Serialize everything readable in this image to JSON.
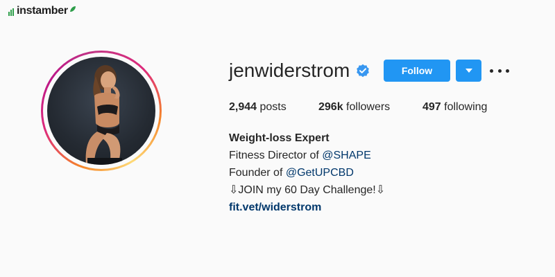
{
  "watermark": {
    "brand": "instamber",
    "brand_color": "#2e9e4a"
  },
  "profile": {
    "username": "jenwiderstrom",
    "verified": true,
    "avatar_alt": "profile photo",
    "ring_colors": [
      "#f58529",
      "#dd2a7b",
      "#bc1888",
      "#feda77"
    ]
  },
  "actions": {
    "follow_label": "Follow",
    "accent_color": "#2196f3",
    "dropdown_icon": "chevron-down-icon",
    "more_icon": "more-options-icon"
  },
  "stats": {
    "posts_count": "2,944",
    "posts_label": "posts",
    "followers_count": "296k",
    "followers_label": "followers",
    "following_count": "497",
    "following_label": "following"
  },
  "bio": {
    "name": "Weight-loss Expert",
    "line1_prefix": "Fitness Director of ",
    "line1_mention": "@SHAPE",
    "line2_prefix": "Founder of ",
    "line2_mention": "@GetUPCBD",
    "line3": "⇩JOIN my 60 Day Challenge!⇩",
    "link": "fit.vet/widerstrom"
  }
}
